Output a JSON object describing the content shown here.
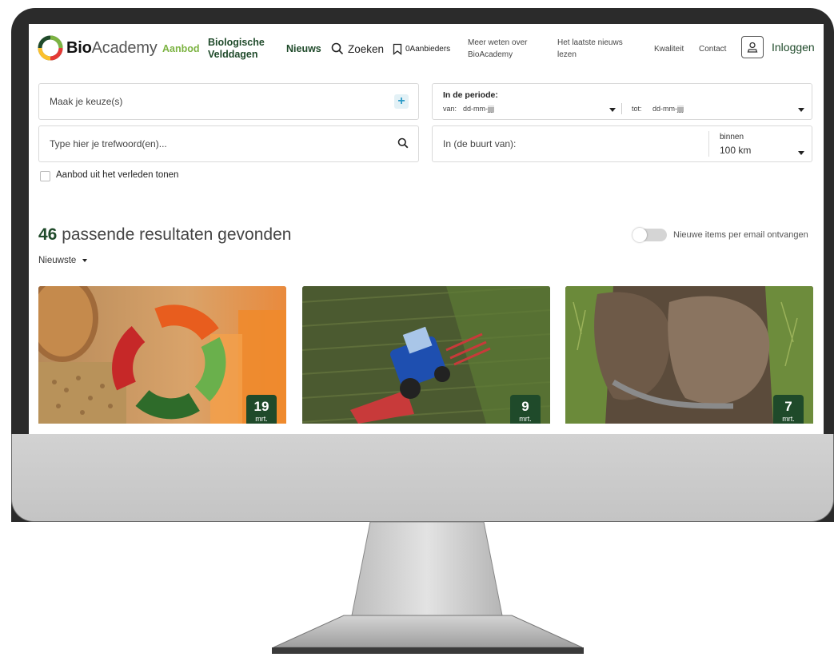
{
  "brand": {
    "bold": "Bio",
    "light": "Academy"
  },
  "nav": {
    "aanbod": "Aanbod",
    "velddagen_1": "Biologische",
    "velddagen_2": "Velddagen",
    "nieuws": "Nieuws",
    "zoeken": "Zoeken",
    "aanbieders": "0Aanbieders",
    "meer_1": "Meer weten over",
    "meer_2": "BioAcademy",
    "laatste_1": "Het laatste nieuws",
    "laatste_2": "lezen",
    "kwaliteit": "Kwaliteit",
    "contact": "Contact",
    "login": "Inloggen"
  },
  "filters": {
    "keuze_placeholder": "Maak je keuze(s)",
    "trefwoord_placeholder": "Type hier je trefwoord(en)...",
    "periode_title": "In de periode:",
    "van_label": "van:",
    "van_value": "dd-mm-jjjj",
    "tot_label": "tot:",
    "tot_value": "dd-mm-jjjj",
    "buurt_placeholder": "In (de buurt van):",
    "binnen_label": "binnen",
    "binnen_value": "100 km",
    "verleden_label": "Aanbod uit het verleden tonen"
  },
  "results": {
    "count": "46",
    "text": "passende resultaten gevonden",
    "sort": "Nieuwste",
    "email_toggle": "Nieuwe items per email ontvangen"
  },
  "cards": [
    {
      "day": "19",
      "month": "mrt."
    },
    {
      "day": "9",
      "month": "mrt."
    },
    {
      "day": "7",
      "month": "mrt."
    }
  ],
  "colors": {
    "brand_green": "#7cb342",
    "dark_green": "#1f4a2a",
    "accent_blue": "#2a9bc7"
  }
}
